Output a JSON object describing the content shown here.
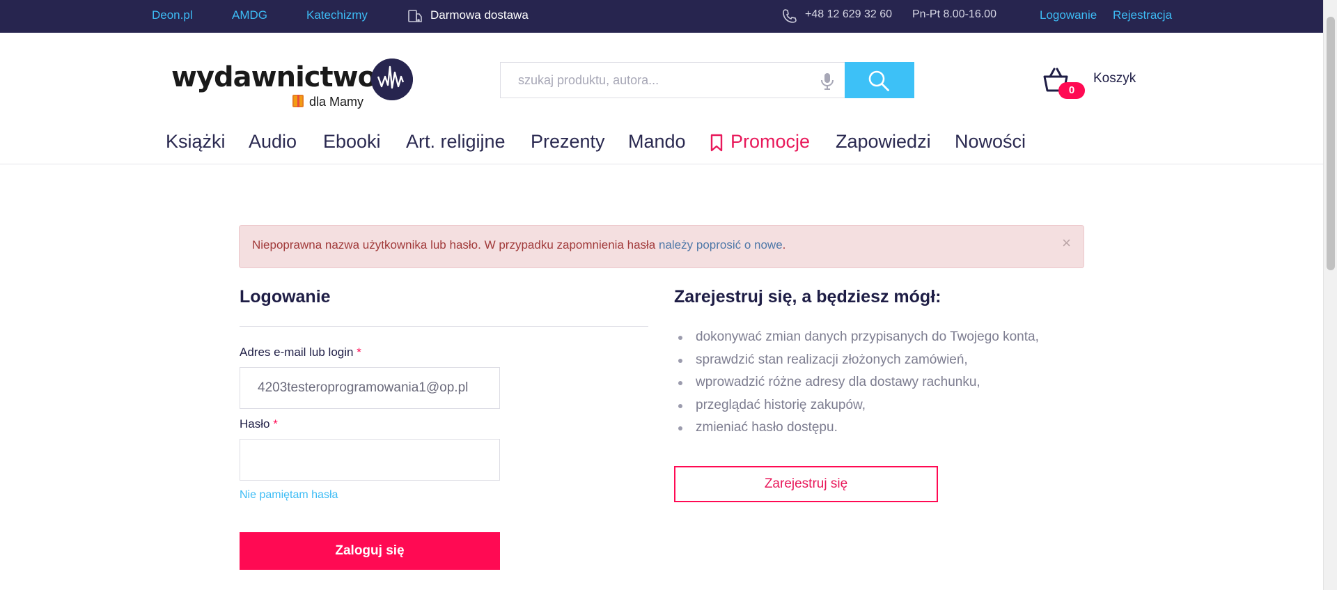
{
  "topbar": {
    "links": [
      "Deon.pl",
      "AMDG",
      "Katechizmy"
    ],
    "delivery": "Darmowa dostawa",
    "phone": "+48 12 629 32 60",
    "hours": "Pn-Pt 8.00-16.00",
    "login": "Logowanie",
    "register": "Rejestracja",
    "colors": {
      "background": "#27254f",
      "link": "#3dbcf5"
    }
  },
  "header": {
    "logo_text": "wydawnictwo",
    "logo_sub": "dla Mamy",
    "search_placeholder": "szukaj produktu, autora...",
    "cart_count": "0",
    "cart_label": "Koszyk"
  },
  "nav": {
    "items": [
      "Książki",
      "Audio",
      "Ebooki",
      "Art. religijne",
      "Prezenty",
      "Mando",
      "Promocje",
      "Zapowiedzi",
      "Nowości"
    ],
    "promo_color": "#e8185a"
  },
  "alert": {
    "message": "Niepoprawna nazwa użytkownika lub hasło. W przypadku zapomnienia hasła",
    "link": "należy poprosić o nowe",
    "close": "×"
  },
  "login": {
    "title": "Logowanie",
    "email_label": "Adres e-mail lub login",
    "email_value": "4203testeroprogramowania1@op.pl",
    "password_label": "Hasło",
    "password_value": "",
    "required_mark": "*",
    "forgot": "Nie pamiętam hasła",
    "submit": "Zaloguj się"
  },
  "register": {
    "title": "Zarejestruj się, a będziesz mógł:",
    "benefits": [
      "dokonywać zmian danych przypisanych do Twojego konta,",
      "sprawdzić stan realizacji złożonych zamówień,",
      "wprowadzić różne adresy dla dostawy rachunku,",
      "przeglądać historię zakupów,",
      "zmieniać hasło dostępu."
    ],
    "button": "Zarejestruj się"
  }
}
